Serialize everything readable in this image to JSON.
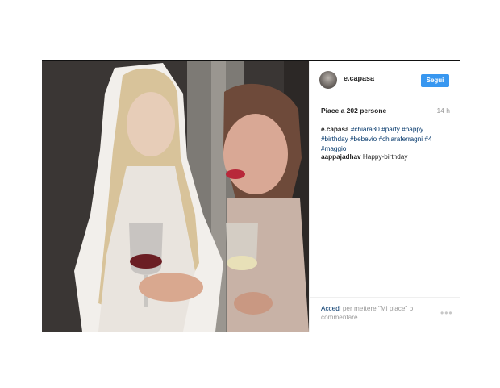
{
  "post": {
    "username": "e.capasa",
    "follow_label": "Segui",
    "likes": "Piace a 202 persone",
    "time": "14 h",
    "caption_user": "e.capasa",
    "hashtags": [
      "#chiara30",
      "#party",
      "#happy",
      "#birthday",
      "#bebevio",
      "#chiaraferragni",
      "#4",
      "#maggio"
    ],
    "comment_user": "aappajadhav",
    "comment_text": "Happy-birthday",
    "login_link": "Accedi",
    "login_text": "per mettere \"Mi piace\" o commentare.",
    "more_glyph": "•••"
  },
  "colors": {
    "follow_button": "#3897f0",
    "hashtag": "#003569",
    "muted": "#999999"
  },
  "icons": {
    "avatar": "profile-photo",
    "more": "more-options-icon"
  }
}
